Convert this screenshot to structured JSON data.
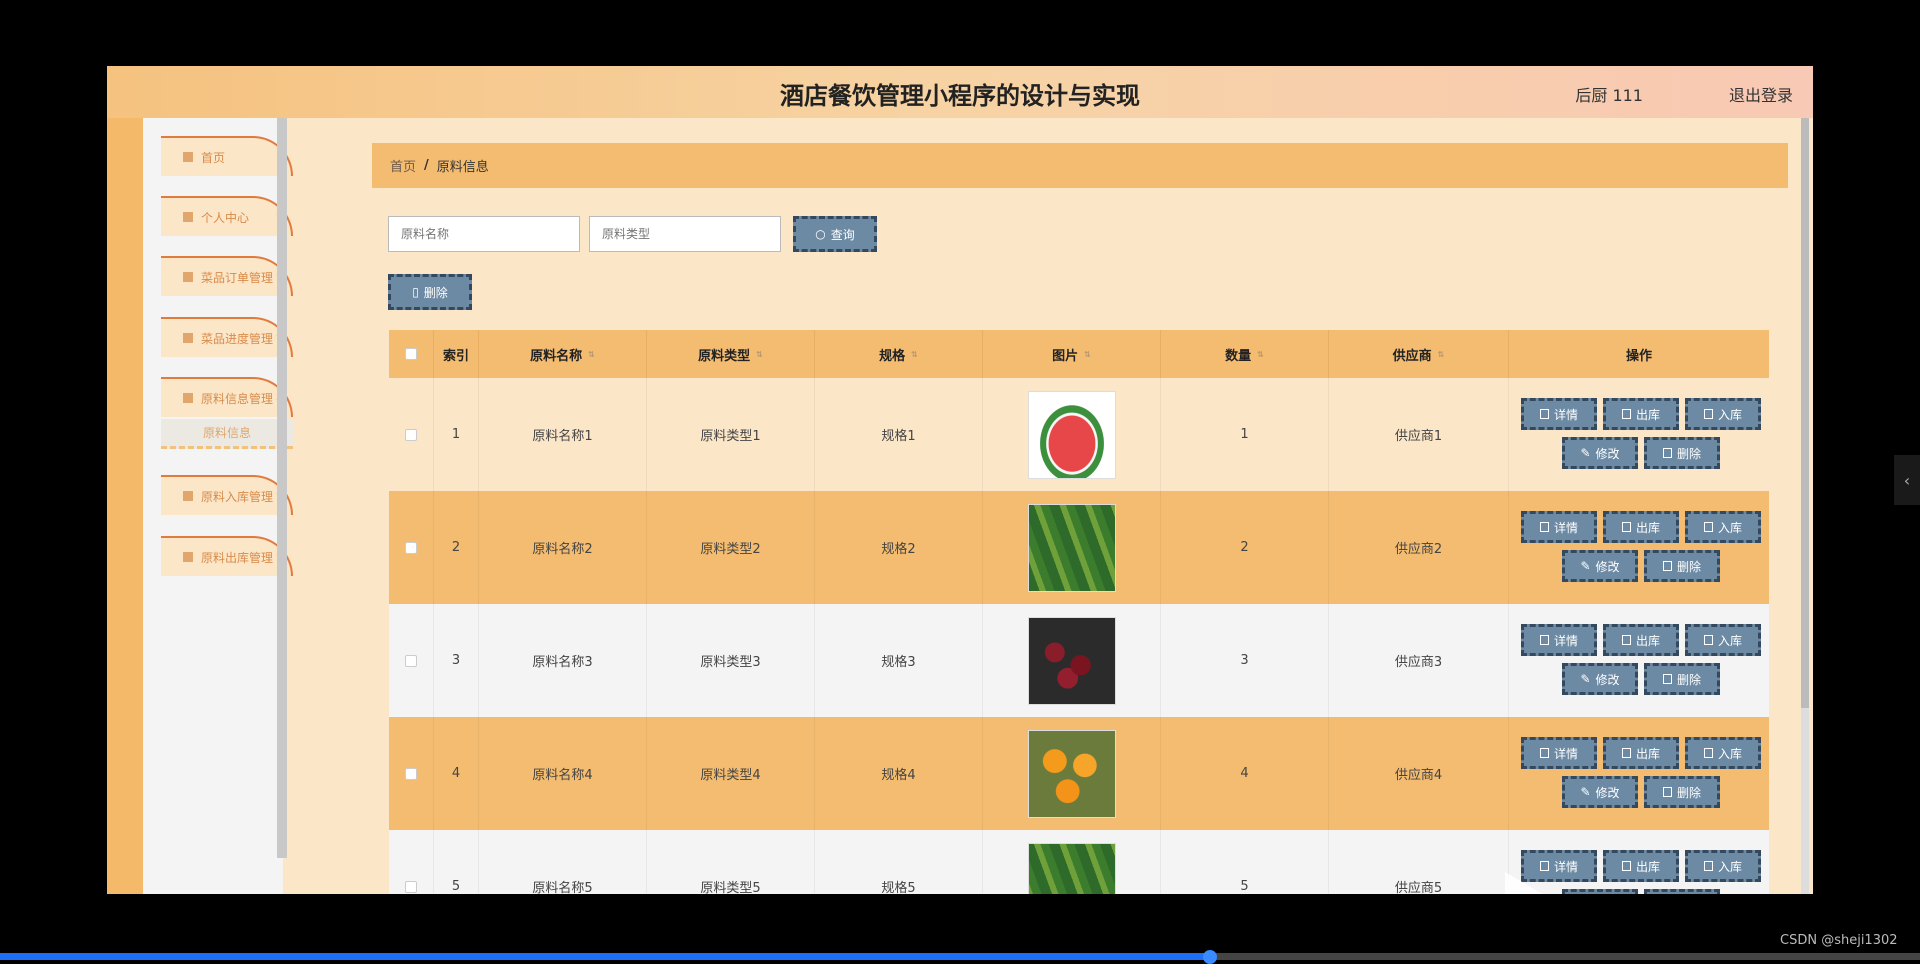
{
  "header": {
    "title": "酒店餐饮管理小程序的设计与实现",
    "user": "后厨 111",
    "logout": "退出登录"
  },
  "sidebar": {
    "items": [
      {
        "label": "首页",
        "has_children": false
      },
      {
        "label": "个人中心",
        "has_children": true
      },
      {
        "label": "菜品订单管理",
        "has_children": true
      },
      {
        "label": "菜品进度管理",
        "has_children": true
      },
      {
        "label": "原料信息管理",
        "has_children": true
      },
      {
        "label": "原料入库管理",
        "has_children": true
      },
      {
        "label": "原料出库管理",
        "has_children": true
      }
    ],
    "active_sub": "原料信息"
  },
  "breadcrumb": {
    "home": "首页",
    "sep": "/",
    "current": "原料信息"
  },
  "search": {
    "name_placeholder": "原料名称",
    "type_placeholder": "原料类型",
    "query_label": "查询",
    "delete_label": "删除"
  },
  "table": {
    "headers": [
      "索引",
      "原料名称",
      "原料类型",
      "规格",
      "图片",
      "数量",
      "供应商",
      "操作"
    ],
    "rows": [
      {
        "index": "1",
        "name": "原料名称1",
        "type": "原料类型1",
        "spec": "规格1",
        "qty": "1",
        "supplier": "供应商1",
        "image": "watermelon"
      },
      {
        "index": "2",
        "name": "原料名称2",
        "type": "原料类型2",
        "spec": "规格2",
        "qty": "2",
        "supplier": "供应商2",
        "image": "cucumber"
      },
      {
        "index": "3",
        "name": "原料名称3",
        "type": "原料类型3",
        "spec": "规格3",
        "qty": "3",
        "supplier": "供应商3",
        "image": "cherry"
      },
      {
        "index": "4",
        "name": "原料名称4",
        "type": "原料类型4",
        "spec": "规格4",
        "qty": "4",
        "supplier": "供应商4",
        "image": "orange"
      },
      {
        "index": "5",
        "name": "原料名称5",
        "type": "原料类型5",
        "spec": "规格5",
        "qty": "5",
        "supplier": "供应商5",
        "image": "cucumber"
      }
    ],
    "actions": {
      "detail": "详情",
      "out": "出库",
      "in": "入库",
      "edit": "修改",
      "delete": "删除"
    }
  },
  "credit": "CSDN @sheji1302",
  "video_progress": 0.63,
  "colors": {
    "accent": "#f4bc70",
    "button": "#6c8aa4",
    "button_border": "#34495e",
    "sidebar_border": "#e07b3d"
  }
}
